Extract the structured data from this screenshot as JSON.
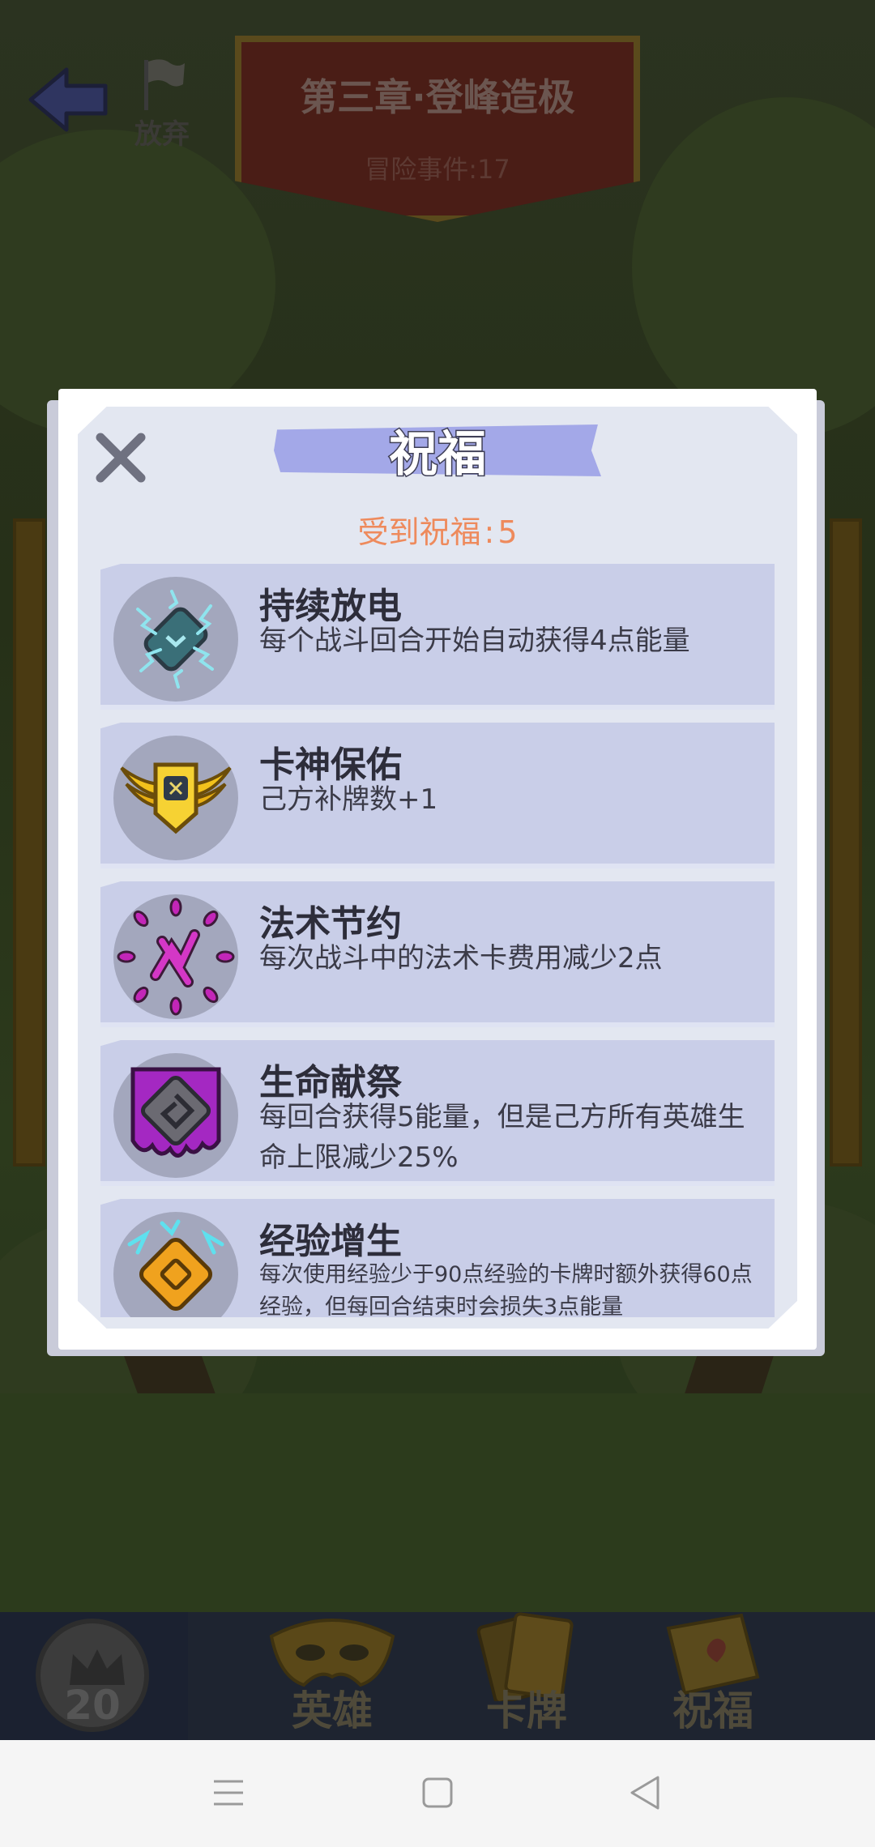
{
  "header": {
    "back_icon": "arrow-left-icon",
    "abandon_label": "放弃",
    "chapter_title": "第三章·登峰造极",
    "events_label": "冒险事件",
    "events_value": "17"
  },
  "modal": {
    "title": "祝福",
    "count_label": "受到祝福",
    "count_value": "5",
    "close_icon": "close-icon",
    "blessings": [
      {
        "name": "持续放电",
        "desc": "每个战斗回合开始自动获得4点能量",
        "icon": "lightning-rune-icon"
      },
      {
        "name": "卡神保佑",
        "desc": "己方补牌数+1",
        "icon": "winged-shield-icon"
      },
      {
        "name": "法术节约",
        "desc": "每次战斗中的法术卡费用减少2点",
        "icon": "magic-splash-icon"
      },
      {
        "name": "生命献祭",
        "desc": "每回合获得5能量，但是己方所有英雄生命上限减少25%",
        "icon": "purple-rune-icon"
      },
      {
        "name": "经验增生",
        "desc": "每次使用经验少于90点经验的卡牌时额外获得60点经验，但每回合结束时会损失3点能量",
        "icon": "gold-rune-icon"
      }
    ]
  },
  "bottom_bar": {
    "level": "20",
    "tabs": [
      {
        "label": "英雄",
        "icon": "hero-mask-icon"
      },
      {
        "label": "卡牌",
        "icon": "cards-icon"
      },
      {
        "label": "祝福",
        "icon": "blessing-book-icon"
      }
    ]
  },
  "system_nav": {
    "menu_icon": "menu-icon",
    "home_icon": "home-icon",
    "back_icon": "back-triangle-icon"
  }
}
